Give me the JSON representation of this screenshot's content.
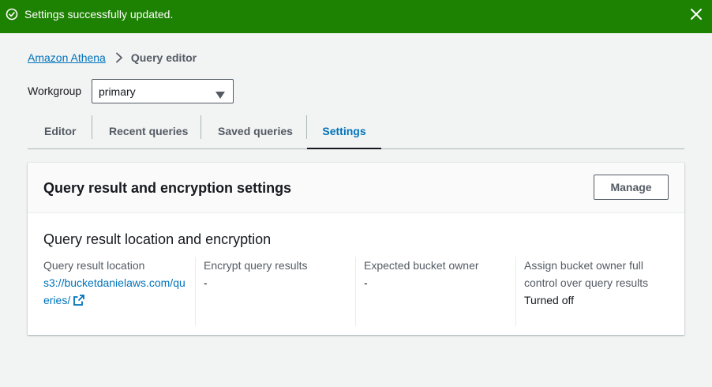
{
  "flash": {
    "message": "Settings successfully updated.",
    "icons": {
      "status": "check-circle-icon",
      "dismiss": "close-icon"
    },
    "color": "#1d8102"
  },
  "breadcrumb": {
    "items": [
      {
        "label": "Amazon Athena"
      },
      {
        "label": "Query editor"
      }
    ],
    "separator_icon": "chevron-right-icon"
  },
  "workgroup": {
    "label": "Workgroup",
    "selected": "primary",
    "icon": "caret-down-icon"
  },
  "tabs": [
    {
      "label": "Editor",
      "active": false
    },
    {
      "label": "Recent queries",
      "active": false
    },
    {
      "label": "Saved queries",
      "active": false
    },
    {
      "label": "Settings",
      "active": true
    }
  ],
  "card": {
    "title": "Query result and encryption settings",
    "manage_label": "Manage",
    "section_title": "Query result location and encryption",
    "fields": [
      {
        "key": "Query result location",
        "value": "s3://bucketdanielaws.com/queries/",
        "is_link": true,
        "icon": "external-link-icon"
      },
      {
        "key": "Encrypt query results",
        "value": "-"
      },
      {
        "key": "Expected bucket owner",
        "value": "-"
      },
      {
        "key": "Assign bucket owner full control over query results",
        "value": "Turned off"
      }
    ]
  },
  "colors": {
    "link": "#0073bb",
    "success": "#1d8102",
    "background": "#f2f3f3"
  }
}
